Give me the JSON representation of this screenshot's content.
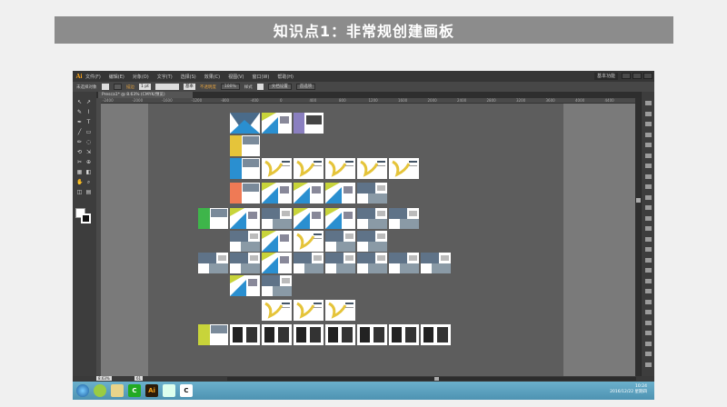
{
  "slide": {
    "title": "知识点1：非常规创建画板"
  },
  "app": {
    "logo": "Ai",
    "menu": [
      "文件(F)",
      "编辑(E)",
      "对象(O)",
      "文字(T)",
      "选择(S)",
      "效果(C)",
      "视图(V)",
      "窗口(W)",
      "帮助(H)"
    ],
    "workspace": "基本功能",
    "control": {
      "selection": "未选择对象",
      "stroke_label": "描边",
      "stroke_value": "1 pt",
      "brush": "基本",
      "opacity_label": "不透明度",
      "opacity_value": "100%",
      "style_label": "样式",
      "doc_setup": "文档设置",
      "prefs": "首选项"
    },
    "document_tab": "Presca1* @ 8.63% (CMYK/预览)",
    "ruler": [
      "-2400",
      "-2000",
      "-1600",
      "-1200",
      "-800",
      "-400",
      "0",
      "400",
      "800",
      "1200",
      "1600",
      "2000",
      "2400",
      "2800",
      "3200",
      "3600",
      "4000",
      "4400"
    ],
    "status": {
      "zoom": "8.63%",
      "artboard": "61"
    },
    "taskbar": {
      "time": "10:24",
      "date": "2016/12/22 星期四"
    },
    "accent_colors": {
      "blue": "#2a8fd0",
      "yellow": "#e5c43a",
      "green": "#3eb54a",
      "orange": "#ef7a55",
      "purple": "#8a7fc0",
      "lime": "#c8d43a"
    }
  }
}
